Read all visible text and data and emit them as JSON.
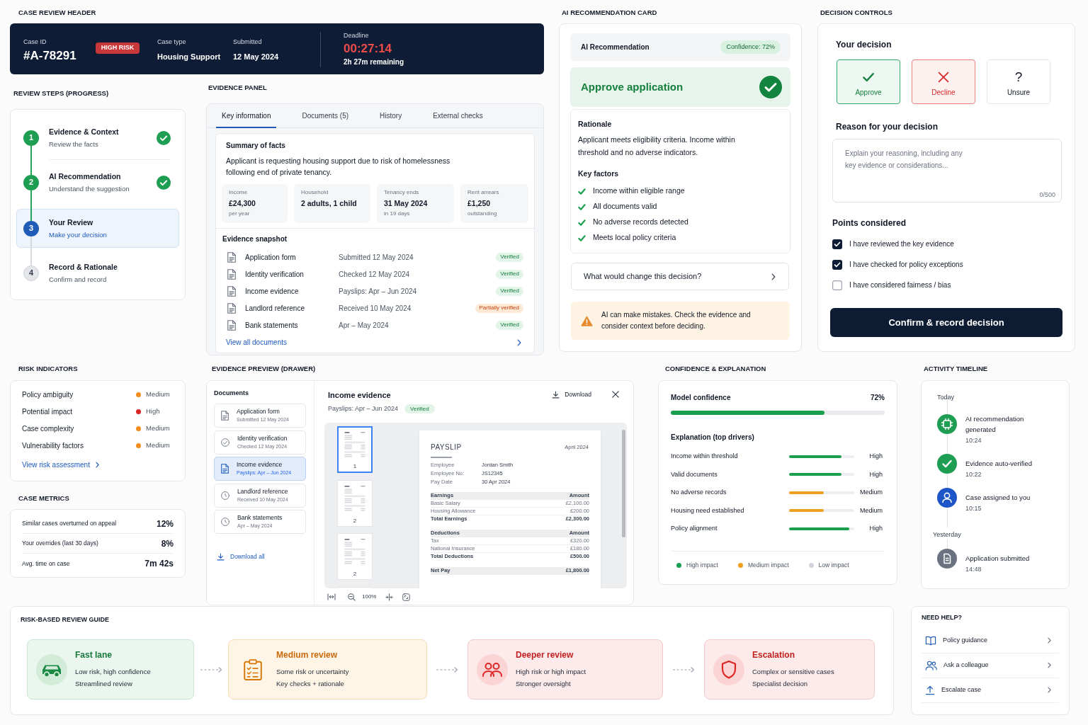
{
  "header": {
    "section_label": "CASE REVIEW HEADER",
    "case_id_label": "Case ID",
    "case_id": "#A-78291",
    "risk_badge": "HIGH RISK",
    "fields": [
      {
        "label": "Case type",
        "value": "Housing Support"
      },
      {
        "label": "Submitted",
        "value": "12 May 2024"
      }
    ],
    "deadline": {
      "label": "Deadline",
      "timer": "00:27:14",
      "remaining": "2h 27m remaining"
    }
  },
  "review_steps": {
    "section_label": "REVIEW STEPS (PROGRESS)",
    "steps": [
      {
        "number": "1",
        "title": "Evidence & Context",
        "subtitle": "Review the facts",
        "completed": true,
        "selected": false
      },
      {
        "number": "2",
        "title": "AI Recommendation",
        "subtitle": "Understand the suggestion",
        "completed": true,
        "selected": false
      },
      {
        "number": "3",
        "title": "Your Review",
        "subtitle": "Make your decision",
        "completed": false,
        "selected": true
      },
      {
        "number": "4",
        "title": "Record & Rationale",
        "subtitle": "Confirm and record",
        "completed": false,
        "selected": false
      }
    ]
  },
  "evidence_panel": {
    "section_label": "EVIDENCE PANEL",
    "tabs": [
      {
        "label": "Key information",
        "selected": true
      },
      {
        "label": "Documents (5)",
        "selected": false
      },
      {
        "label": "History",
        "selected": false
      },
      {
        "label": "External checks",
        "selected": false
      }
    ],
    "summary": {
      "title": "Summary of facts",
      "text": "Applicant is requesting housing support due to risk of homelessness following end of private tenancy.",
      "facts": [
        {
          "label": "Income",
          "value": "£24,300",
          "note": "per year"
        },
        {
          "label": "Household",
          "value": "2 adults, 1 child"
        },
        {
          "label": "Tenancy ends",
          "value": "31 May 2024",
          "note": "in 19 days"
        },
        {
          "label": "Rent arrears",
          "value": "£1,250",
          "note": "outstanding"
        }
      ]
    },
    "snapshot": {
      "title": "Evidence snapshot",
      "items": [
        {
          "name": "Application form",
          "detail": "Submitted 12 May 2024",
          "status": "Verified",
          "kind": "verified"
        },
        {
          "name": "Identity verification",
          "detail": "Checked 12 May 2024",
          "status": "Verified",
          "kind": "verified"
        },
        {
          "name": "Income evidence",
          "detail": "Payslips: Apr – Jun 2024",
          "status": "Verified",
          "kind": "verified"
        },
        {
          "name": "Landlord reference",
          "detail": "Received 10 May 2024",
          "status": "Partially verified",
          "kind": "partial"
        },
        {
          "name": "Bank statements",
          "detail": "Apr – May 2024",
          "status": "Verified",
          "kind": "verified"
        }
      ],
      "link": "View all documents"
    }
  },
  "ai_recommendation": {
    "section_label": "AI RECOMMENDATION CARD",
    "title": "AI Recommendation",
    "confidence_badge": "Confidence: 72%",
    "verdict": "Approve application",
    "rationale_title": "Rationale",
    "rationale": "Applicant meets eligibility criteria. Income within threshold and no adverse indicators.",
    "key_factors_title": "Key factors",
    "key_factors": [
      "Income within eligible range",
      "All documents valid",
      "No adverse records detected",
      "Meets local policy criteria"
    ],
    "what_if": "What would change this decision?",
    "warning": "AI can make mistakes. Check the evidence and consider context before deciding."
  },
  "decision": {
    "section_label": "DECISION CONTROLS",
    "title": "Your decision",
    "options": [
      {
        "label": "Approve",
        "kind": "approve",
        "selected": false
      },
      {
        "label": "Decline",
        "kind": "decline",
        "selected": false
      },
      {
        "label": "Unsure",
        "kind": "unsure",
        "symbol": "?",
        "selected": false
      }
    ],
    "reason_title": "Reason for your decision",
    "reason_placeholder": "Explain your reasoning, including any key evidence or considerations...",
    "char_count": "0/500",
    "points_title": "Points considered",
    "points": [
      {
        "label": "I have reviewed the key evidence",
        "checked": true
      },
      {
        "label": "I have checked for policy exceptions",
        "checked": true
      },
      {
        "label": "I have considered fairness / bias",
        "checked": false
      }
    ],
    "confirm_button": "Confirm & record decision"
  },
  "risk_indicators": {
    "section_label": "RISK INDICATORS",
    "items": [
      {
        "label": "Policy ambiguity",
        "rating": "Medium",
        "color": "#f28c1b"
      },
      {
        "label": "Potential impact",
        "rating": "High",
        "color": "#dc2626"
      },
      {
        "label": "Case complexity",
        "rating": "Medium",
        "color": "#f28c1b"
      },
      {
        "label": "Vulnerability factors",
        "rating": "Medium",
        "color": "#f28c1b"
      }
    ],
    "link": "View risk assessment"
  },
  "case_metrics": {
    "section_label": "CASE METRICS",
    "rows": [
      {
        "label": "Similar cases overturned on appeal",
        "value": "12%"
      },
      {
        "label": "Your overrides (last 30 days)",
        "value": "8%"
      },
      {
        "label": "Avg. time on case",
        "value": "7m 42s"
      }
    ]
  },
  "evidence_preview": {
    "section_label": "EVIDENCE PREVIEW (DRAWER)",
    "documents_title": "Documents",
    "documents": [
      {
        "name": "Application form",
        "detail": "Submitted 12 May 2024",
        "selected": false
      },
      {
        "name": "Identity verification",
        "detail": "Checked 12 May 2024",
        "selected": false
      },
      {
        "name": "Income evidence",
        "detail": "Payslips: Apr – Jun 2024",
        "selected": true
      },
      {
        "name": "Landlord reference",
        "detail": "Received 10 May 2024",
        "selected": false
      },
      {
        "name": "Bank statements",
        "detail": "Apr – May 2024",
        "selected": false
      }
    ],
    "download_all": "Download all",
    "viewer": {
      "title": "Income evidence",
      "subtitle": "Payslips: Apr – Jun 2024",
      "badge": "Verified",
      "download": "Download",
      "thumbnails": [
        {
          "page": "1",
          "selected": true
        },
        {
          "page": "2",
          "selected": false
        },
        {
          "page": "2",
          "selected": false
        },
        {
          "selected": false
        }
      ],
      "zoom": "100%",
      "payslip": {
        "title": "PAYSLIP",
        "period": "April 2024",
        "fields": [
          {
            "label": "Employee",
            "value": "Jordan Smith"
          },
          {
            "label": "Employee No:",
            "value": "JS12345"
          },
          {
            "label": "Pay Date",
            "value": "30 Apr 2024"
          }
        ],
        "sections": [
          {
            "heading": "Earnings",
            "amount_heading": "Amount",
            "rows": [
              {
                "label": "Basic Salary",
                "amount": "£2,100.00"
              },
              {
                "label": "Housing Allowance",
                "amount": "£200.00"
              }
            ],
            "total": {
              "label": "Total Earnings",
              "amount": "£2,300.00"
            }
          },
          {
            "heading": "Deductions",
            "amount_heading": "Amount",
            "rows": [
              {
                "label": "Tax",
                "amount": "£320.00"
              },
              {
                "label": "National Insurance",
                "amount": "£180.00"
              }
            ],
            "total": {
              "label": "Total Deductions",
              "amount": "£500.00"
            }
          }
        ],
        "net_pay": {
          "label": "Net Pay",
          "amount": "£1,800.00"
        }
      }
    }
  },
  "confidence": {
    "section_label": "CONFIDENCE & EXPLANATION",
    "title": "Model confidence",
    "value": "72%",
    "level": 0.72,
    "drivers_title": "Explanation (top drivers)",
    "drivers": [
      {
        "label": "Income within threshold",
        "level": 0.8,
        "rating": "High",
        "color": "#1a9f50"
      },
      {
        "label": "Valid documents",
        "level": 0.8,
        "rating": "High",
        "color": "#1a9f50"
      },
      {
        "label": "No adverse records",
        "level": 0.53,
        "rating": "Medium",
        "color": "#f0a020"
      },
      {
        "label": "Housing need established",
        "level": 0.53,
        "rating": "Medium",
        "color": "#f0a020"
      },
      {
        "label": "Policy alignment",
        "level": 0.92,
        "rating": "High",
        "color": "#1a9f50"
      }
    ],
    "legend": [
      {
        "label": "High impact",
        "color": "#1a9f50"
      },
      {
        "label": "Medium impact",
        "color": "#f0a020"
      },
      {
        "label": "Low impact",
        "color": "#d1d5db"
      }
    ]
  },
  "activity": {
    "section_label": "ACTIVITY TIMELINE",
    "groups": [
      {
        "label": "Today",
        "events": [
          {
            "title": "AI recommendation generated",
            "time": "10:24",
            "kind": "ai"
          },
          {
            "title": "Evidence auto-verified",
            "time": "10:22",
            "kind": "verified"
          },
          {
            "title": "Case assigned to you",
            "time": "10:15",
            "kind": "assigned"
          }
        ]
      },
      {
        "label": "Yesterday",
        "events": [
          {
            "title": "Application submitted",
            "time": "14:48",
            "kind": "submitted"
          }
        ]
      }
    ]
  },
  "review_guide": {
    "section_label": "RISK-BASED REVIEW GUIDE",
    "lanes": [
      {
        "title": "Fast lane",
        "lines": [
          "Low risk, high confidence",
          "Streamlined review"
        ],
        "kind": "fast"
      },
      {
        "title": "Medium review",
        "lines": [
          "Some risk or uncertainty",
          "Key checks + rationale"
        ],
        "kind": "medium"
      },
      {
        "title": "Deeper review",
        "lines": [
          "High risk or high impact",
          "Stronger oversight"
        ],
        "kind": "deeper"
      },
      {
        "title": "Escalation",
        "lines": [
          "Complex or sensitive cases",
          "Specialist decision"
        ],
        "kind": "escalation"
      }
    ]
  },
  "help": {
    "section_label": "NEED HELP?",
    "links": [
      "Policy guidance",
      "Ask a colleague",
      "Escalate case"
    ]
  }
}
